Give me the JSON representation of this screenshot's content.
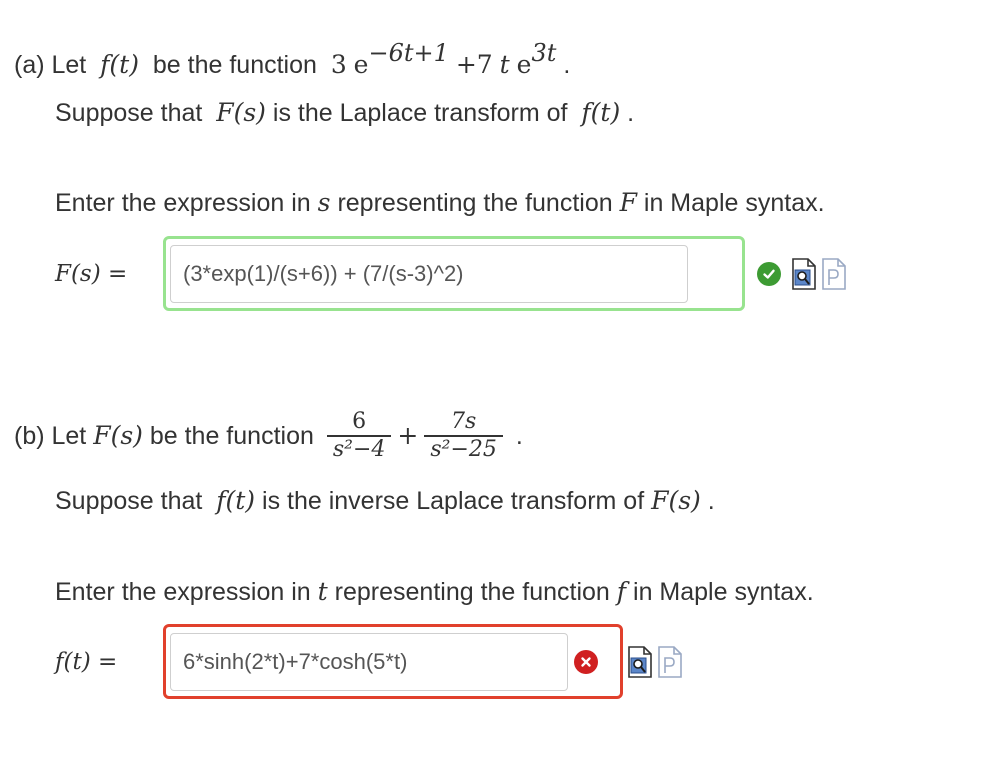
{
  "part_a": {
    "intro_prefix": "(a) Let",
    "function_symbol": "f(t)",
    "intro_middle": "be the function",
    "func_coef1": "3",
    "func_base1": "e",
    "func_exp1": "−6t+1",
    "func_plus_term": "+7",
    "func_t": "t",
    "func_base2": "e",
    "func_exp2": "3t",
    "func_period": ".",
    "suppose_prefix": "Suppose that",
    "suppose_symbol": "F(s)",
    "suppose_middle": "is the Laplace transform of",
    "suppose_symbol2": "f(t)",
    "suppose_period": ".",
    "instruction_prefix": "Enter the expression in",
    "instruction_var": "s",
    "instruction_middle": "representing the function",
    "instruction_func": "F",
    "instruction_suffix": "in Maple syntax.",
    "answer_label": "F(s) =",
    "answer_value": "(3*exp(1)/(s+6)) + (7/(s-3)^2)",
    "status": "correct"
  },
  "part_b": {
    "intro_prefix": "(b) Let",
    "function_symbol": "F(s)",
    "intro_middle": "be the function",
    "frac1_num": "6",
    "frac1_den": "s²−4",
    "plus": "+",
    "frac2_num": "7s",
    "frac2_den": "s²−25",
    "func_period": ".",
    "suppose_prefix": "Suppose that",
    "suppose_symbol": "f(t)",
    "suppose_middle": "is the inverse Laplace transform of",
    "suppose_symbol2": "F(s)",
    "suppose_period": ".",
    "instruction_prefix": "Enter the expression in",
    "instruction_var": "t",
    "instruction_middle": "representing the function",
    "instruction_func": "f",
    "instruction_suffix": "in Maple syntax.",
    "answer_label": "f(t) =",
    "answer_value": "6*sinh(2*t)+7*cosh(5*t)",
    "status": "incorrect"
  },
  "icons": {
    "correct": "check-circle-icon",
    "incorrect": "x-circle-icon",
    "preview": "preview-document-icon",
    "maple": "maple-document-icon"
  },
  "colors": {
    "correct_border": "#98e38f",
    "incorrect_border": "#e1402c",
    "correct_badge": "#3d9b33",
    "incorrect_badge": "#d02021"
  }
}
